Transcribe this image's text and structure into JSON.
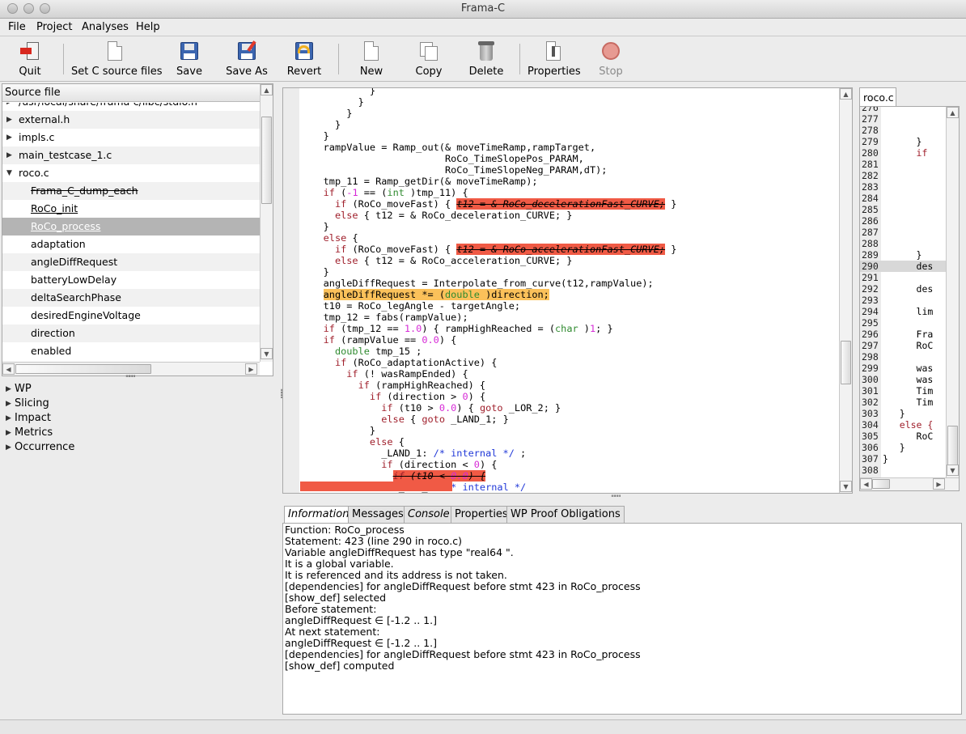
{
  "window": {
    "title": "Frama-C"
  },
  "menu": [
    "File",
    "Project",
    "Analyses",
    "Help"
  ],
  "toolbar": [
    {
      "label": "Quit",
      "icon": "quit-icon"
    },
    {
      "label": "Set C source files",
      "icon": "document-icon"
    },
    {
      "label": "Save",
      "icon": "save-icon"
    },
    {
      "label": "Save As",
      "icon": "save-as-icon"
    },
    {
      "label": "Revert",
      "icon": "revert-icon"
    },
    {
      "label": "New",
      "icon": "new-document-icon"
    },
    {
      "label": "Copy",
      "icon": "copy-icon"
    },
    {
      "label": "Delete",
      "icon": "trash-icon"
    },
    {
      "label": "Properties",
      "icon": "properties-icon"
    },
    {
      "label": "Stop",
      "icon": "stop-icon"
    }
  ],
  "source_tree": {
    "header": "Source file",
    "rows": [
      {
        "text": "/usr/local/share/frama-c/libc/stdio.h"
      },
      {
        "text": "external.h"
      },
      {
        "text": "impls.c"
      },
      {
        "text": "main_testcase_1.c"
      },
      {
        "text": "roco.c"
      },
      {
        "text": "Frama_C_dump_each"
      },
      {
        "text": "RoCo_init"
      },
      {
        "text": "RoCo_process"
      },
      {
        "text": "adaptation"
      },
      {
        "text": "angleDiffRequest"
      },
      {
        "text": "batteryLowDelay"
      },
      {
        "text": "deltaSearchPhase"
      },
      {
        "text": "desiredEngineVoltage"
      },
      {
        "text": "direction"
      },
      {
        "text": "enabled"
      }
    ]
  },
  "plugins": [
    "WP",
    "Slicing",
    "Impact",
    "Metrics",
    "Occurrence"
  ],
  "code": {
    "lines": [
      "            }",
      "          }",
      "        }",
      "      }",
      "    }",
      "    rampValue = Ramp_out(& moveTimeRamp,rampTarget,",
      "                         RoCo_TimeSlopePos_PARAM,",
      "                         RoCo_TimeSlopeNeg_PARAM,dT);",
      "    tmp_11 = Ramp_getDir(& moveTimeRamp);",
      "    if (-1 == (int )tmp_11) {",
      "      if (RoCo_moveFast) { t12 = & RoCo_decelerationFast_CURVE; }",
      "      else { t12 = & RoCo_deceleration_CURVE; }",
      "    }",
      "    else {",
      "      if (RoCo_moveFast) { t12 = & RoCo_accelerationFast_CURVE; }",
      "      else { t12 = & RoCo_acceleration_CURVE; }",
      "    }",
      "    angleDiffRequest = Interpolate_from_curve(t12,rampValue);",
      "    angleDiffRequest *= (double )direction;",
      "    t10 = RoCo_legAngle - targetAngle;",
      "    tmp_12 = fabs(rampValue);",
      "    if (tmp_12 == 1.0) { rampHighReached = (char )1; }",
      "    if (rampValue == 0.0) {",
      "      double tmp_15 ;",
      "      if (RoCo_adaptationActive) {",
      "        if (! wasRampEnded) {",
      "          if (rampHighReached) {",
      "            if (direction > 0) {",
      "              if (t10 > 0.0) { goto _LOR_2; }",
      "              else { goto _LAND_1; }",
      "            }",
      "            else {",
      "              _LAND_1: /* internal */ ;",
      "              if (direction < 0) {",
      "                if (t10 < 0.0) {",
      "                 _LOR_2: /* internal */"
    ]
  },
  "right_pane": {
    "tab": "roco.c",
    "lines": [
      {
        "n": "276",
        "c": ""
      },
      {
        "n": "277",
        "c": ""
      },
      {
        "n": "278",
        "c": ""
      },
      {
        "n": "279",
        "c": "      }"
      },
      {
        "n": "280",
        "c": "      if"
      },
      {
        "n": "281",
        "c": ""
      },
      {
        "n": "282",
        "c": ""
      },
      {
        "n": "283",
        "c": ""
      },
      {
        "n": "284",
        "c": ""
      },
      {
        "n": "285",
        "c": ""
      },
      {
        "n": "286",
        "c": ""
      },
      {
        "n": "287",
        "c": ""
      },
      {
        "n": "288",
        "c": ""
      },
      {
        "n": "289",
        "c": "      }"
      },
      {
        "n": "290",
        "c": "      des"
      },
      {
        "n": "291",
        "c": ""
      },
      {
        "n": "292",
        "c": "      des"
      },
      {
        "n": "293",
        "c": ""
      },
      {
        "n": "294",
        "c": "      lim"
      },
      {
        "n": "295",
        "c": ""
      },
      {
        "n": "296",
        "c": "      Fra"
      },
      {
        "n": "297",
        "c": "      RoC"
      },
      {
        "n": "298",
        "c": ""
      },
      {
        "n": "299",
        "c": "      was"
      },
      {
        "n": "300",
        "c": "      was"
      },
      {
        "n": "301",
        "c": "      Tim"
      },
      {
        "n": "302",
        "c": "      Tim"
      },
      {
        "n": "303",
        "c": "   }"
      },
      {
        "n": "304",
        "c": "   else {"
      },
      {
        "n": "305",
        "c": "      RoC"
      },
      {
        "n": "306",
        "c": "   }"
      },
      {
        "n": "307",
        "c": "}"
      },
      {
        "n": "308",
        "c": ""
      }
    ]
  },
  "info_tabs": [
    "Information",
    "Messages",
    "Console",
    "Properties",
    "WP Proof Obligations"
  ],
  "info_lines": [
    "Function: RoCo_process",
    "Statement: 423 (line 290 in roco.c)",
    "Variable angleDiffRequest has type \"real64 \".",
    "It is a global variable.",
    "It is referenced and its address is not taken.",
    "[dependencies] for angleDiffRequest before stmt 423 in RoCo_process",
    "[show_def] selected",
    "Before statement:",
    "angleDiffRequest ∈ [-1.2 .. 1.]",
    "At next statement:",
    "angleDiffRequest ∈ [-1.2 .. 1.]",
    "[dependencies] for angleDiffRequest before stmt 423 in RoCo_process",
    "[show_def] computed"
  ]
}
